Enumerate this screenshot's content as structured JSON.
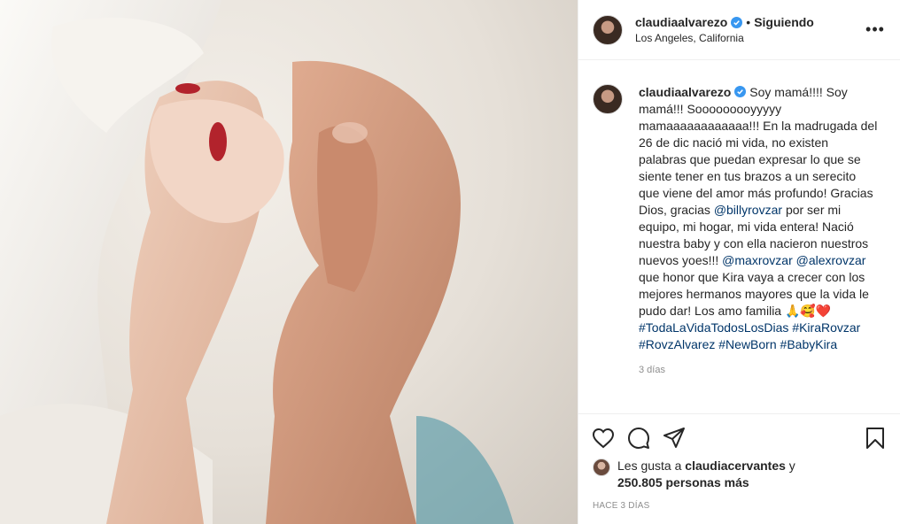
{
  "header": {
    "username": "claudiaalvarezo",
    "separator": "•",
    "follow_status": "Siguiendo",
    "location": "Los Angeles, California",
    "more_label": "•••"
  },
  "caption": {
    "username": "claudiaalvarezo",
    "part1": "Soy mamá!!!! Soy mamá!!! Sooooooooyyyyy mamaaaaaaaaaaaa!!! En la madrugada del 26 de dic nació mi vida, no existen palabras que puedan expresar lo que se siente tener en tus brazos a un serecito que viene del amor más profundo! Gracias Dios, gracias",
    "mention1": "@billyrovzar",
    "part2": "por ser mi equipo, mi hogar, mi vida entera! Nació nuestra baby y con ella nacieron nuestros nuevos yoes!!!",
    "mention2": "@maxrovzar",
    "mention3": "@alexrovzar",
    "part3": "que honor que Kira vaya a crecer con los mejores hermanos mayores que la vida le pudo dar! Los amo familia",
    "emojis": "🙏🥰❤️",
    "hashtags": [
      "#TodaLaVidaTodosLosDias",
      "#KiraRovzar",
      "#RovzAlvarez",
      "#NewBorn",
      "#BabyKira"
    ],
    "time": "3 días"
  },
  "likes": {
    "prefix": "Les gusta a",
    "liker": "claudiacervantes",
    "connector": "y",
    "others": "250.805 personas más"
  },
  "timestamp": "HACE 3 DÍAS",
  "icons": [
    "heart-icon",
    "comment-icon",
    "share-icon",
    "bookmark-icon",
    "verified-badge-icon",
    "more-options-icon"
  ],
  "colors": {
    "verified": "#3897f0",
    "link": "#003569",
    "muted": "#8e8e8e"
  }
}
